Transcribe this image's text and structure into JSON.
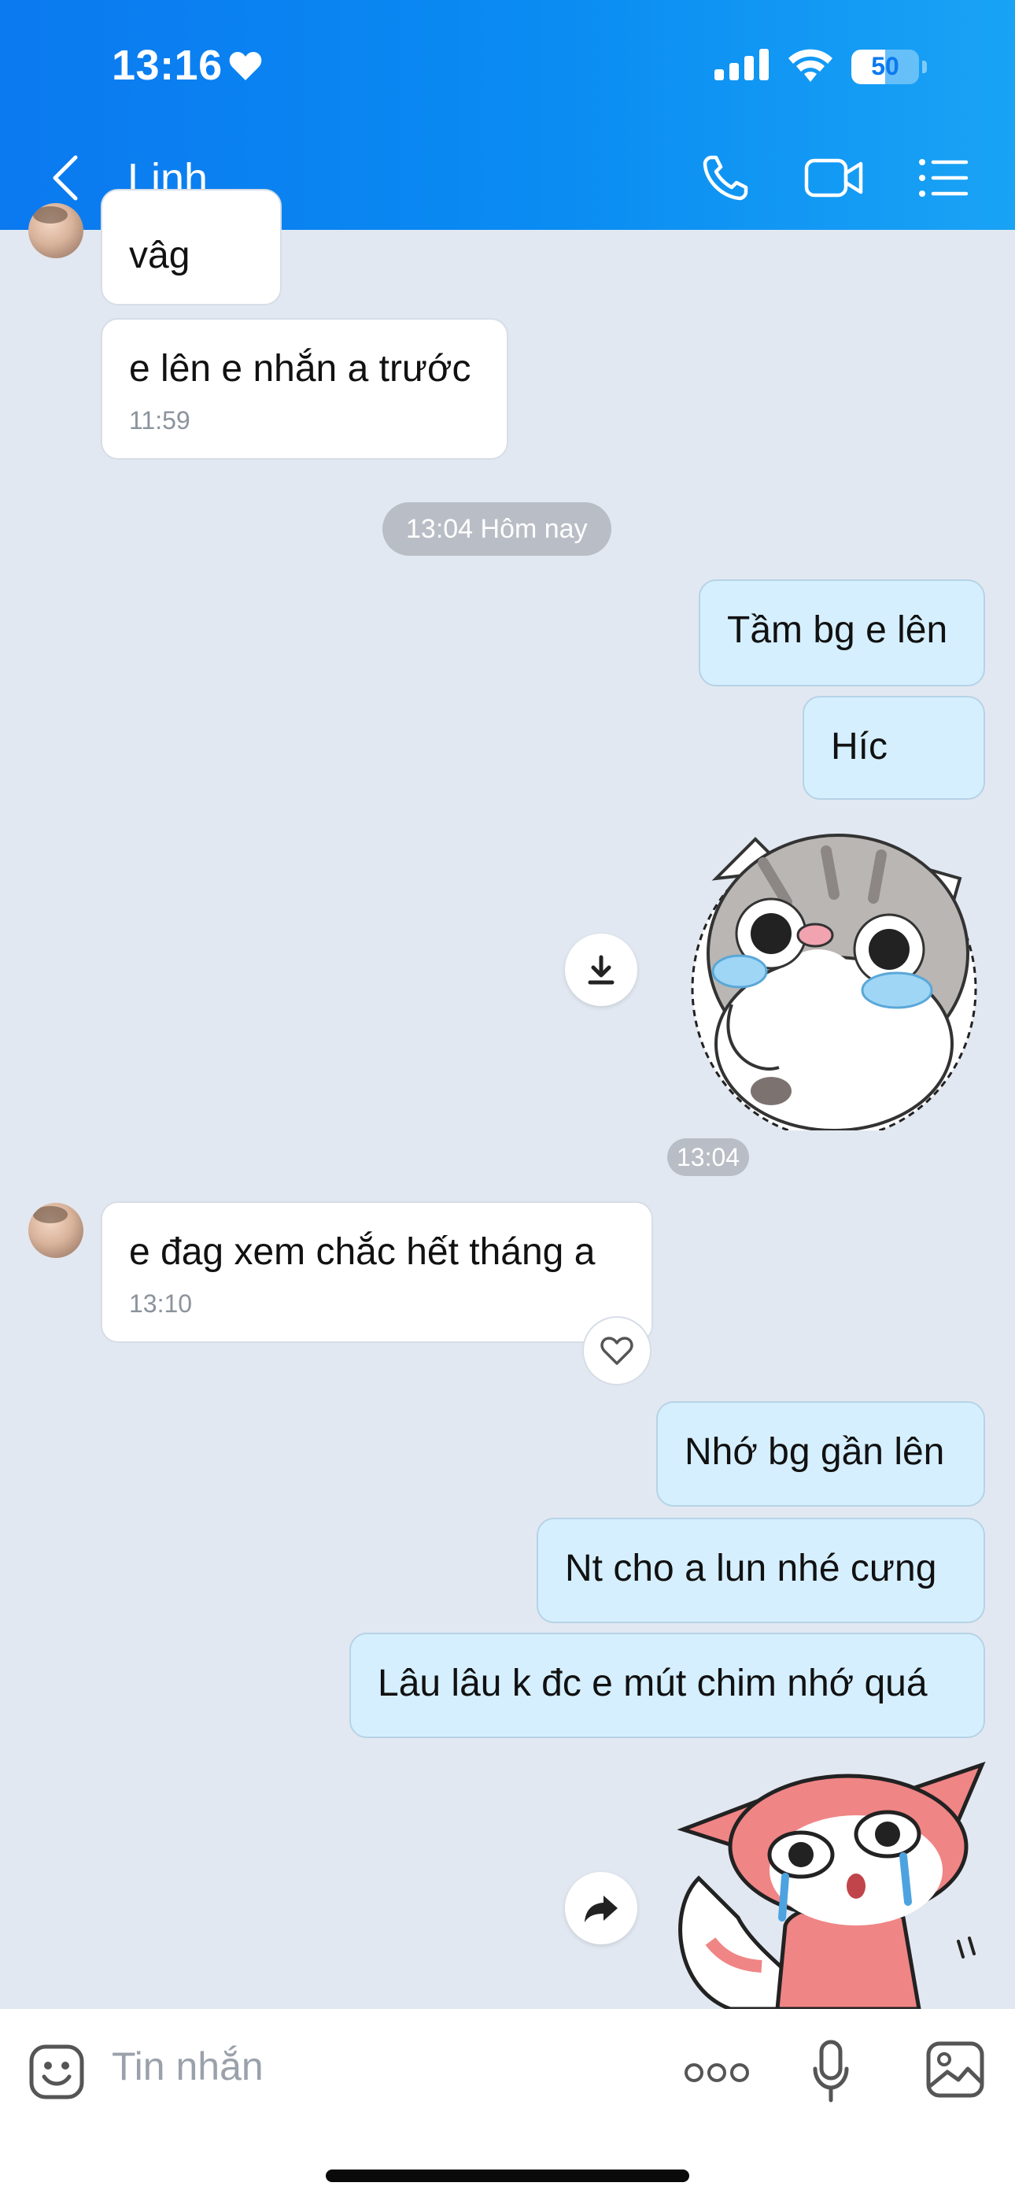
{
  "status_bar": {
    "time": "13:16",
    "battery": "50",
    "battery_level": 0.5
  },
  "header": {
    "contact_name": "Linh",
    "icons": [
      "back-chevron-icon",
      "phone-icon",
      "video-call-icon",
      "menu-list-icon"
    ]
  },
  "messages": {
    "m1": {
      "text": "vâg"
    },
    "m2": {
      "text": "e lên e nhắn a trước",
      "time": "11:59"
    },
    "date_separator": "13:04 Hôm nay",
    "m3": {
      "text": "Tầm bg e lên"
    },
    "m4": {
      "text": "Híc"
    },
    "sticker1_time": "13:04",
    "m5": {
      "text": "e đag xem chắc hết tháng a",
      "time": "13:10"
    },
    "m6": {
      "text": "Nhớ bg gần lên"
    },
    "m7": {
      "text": "Nt cho a lun nhé cưng"
    },
    "m8": {
      "text": "Lâu lâu k đc e mút chim nhớ quá"
    }
  },
  "input": {
    "placeholder": "Tin nhắn",
    "icons": [
      "emoji-icon",
      "more-dots-icon",
      "microphone-icon",
      "image-icon"
    ]
  },
  "colors": {
    "header": "#0b79f0",
    "background": "#e2e8f1",
    "outgoing_bubble": "#d5efff",
    "incoming_bubble": "#ffffff"
  }
}
